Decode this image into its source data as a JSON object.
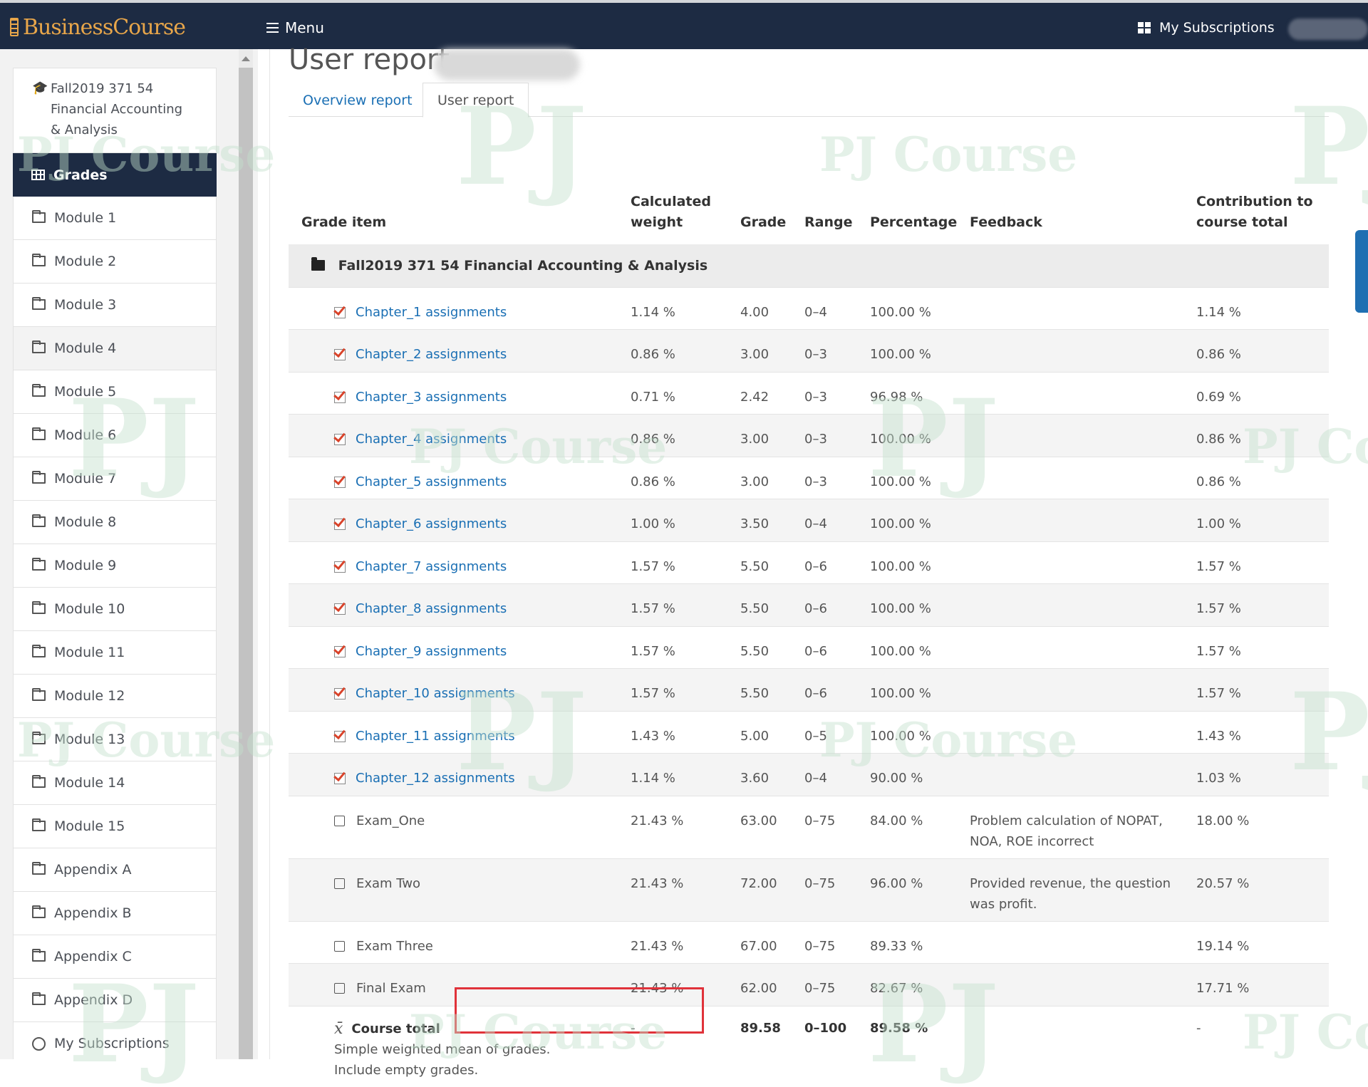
{
  "topbar": {
    "logo_text": "BusinessCourse",
    "menu_label": "Menu",
    "subscriptions_label": "My Subscriptions"
  },
  "sidebar": {
    "course_name": "Fall2019 371 54 Financial Accounting & Analysis",
    "active_label": "Grades",
    "items": [
      "Module 1",
      "Module 2",
      "Module 3",
      "Module 4",
      "Module 5",
      "Module 6",
      "Module 7",
      "Module 8",
      "Module 9",
      "Module 10",
      "Module 11",
      "Module 12",
      "Module 13",
      "Module 14",
      "Module 15",
      "Appendix A",
      "Appendix B",
      "Appendix C",
      "Appendix D"
    ],
    "bottom_item": "My Subscriptions"
  },
  "page": {
    "title": "User report",
    "tabs": [
      "Overview report",
      "User report"
    ]
  },
  "table": {
    "headers": {
      "item": "Grade item",
      "weight": "Calculated weight",
      "grade": "Grade",
      "range": "Range",
      "percentage": "Percentage",
      "feedback": "Feedback",
      "contribution": "Contribution to course total"
    },
    "category": "Fall2019 371 54 Financial Accounting & Analysis",
    "assignments": [
      {
        "name": "Chapter_1 assignments",
        "weight": "1.14 %",
        "grade": "4.00",
        "range": "0–4",
        "percentage": "100.00 %",
        "feedback": "",
        "contribution": "1.14 %"
      },
      {
        "name": "Chapter_2 assignments",
        "weight": "0.86 %",
        "grade": "3.00",
        "range": "0–3",
        "percentage": "100.00 %",
        "feedback": "",
        "contribution": "0.86 %"
      },
      {
        "name": "Chapter_3 assignments",
        "weight": "0.71 %",
        "grade": "2.42",
        "range": "0–3",
        "percentage": "96.98 %",
        "feedback": "",
        "contribution": "0.69 %"
      },
      {
        "name": "Chapter_4 assignments",
        "weight": "0.86 %",
        "grade": "3.00",
        "range": "0–3",
        "percentage": "100.00 %",
        "feedback": "",
        "contribution": "0.86 %"
      },
      {
        "name": "Chapter_5 assignments",
        "weight": "0.86 %",
        "grade": "3.00",
        "range": "0–3",
        "percentage": "100.00 %",
        "feedback": "",
        "contribution": "0.86 %"
      },
      {
        "name": "Chapter_6 assignments",
        "weight": "1.00 %",
        "grade": "3.50",
        "range": "0–4",
        "percentage": "100.00 %",
        "feedback": "",
        "contribution": "1.00 %"
      },
      {
        "name": "Chapter_7 assignments",
        "weight": "1.57 %",
        "grade": "5.50",
        "range": "0–6",
        "percentage": "100.00 %",
        "feedback": "",
        "contribution": "1.57 %"
      },
      {
        "name": "Chapter_8 assignments",
        "weight": "1.57 %",
        "grade": "5.50",
        "range": "0–6",
        "percentage": "100.00 %",
        "feedback": "",
        "contribution": "1.57 %"
      },
      {
        "name": "Chapter_9 assignments",
        "weight": "1.57 %",
        "grade": "5.50",
        "range": "0–6",
        "percentage": "100.00 %",
        "feedback": "",
        "contribution": "1.57 %"
      },
      {
        "name": "Chapter_10 assignments",
        "weight": "1.57 %",
        "grade": "5.50",
        "range": "0–6",
        "percentage": "100.00 %",
        "feedback": "",
        "contribution": "1.57 %"
      },
      {
        "name": "Chapter_11 assignments",
        "weight": "1.43 %",
        "grade": "5.00",
        "range": "0–5",
        "percentage": "100.00 %",
        "feedback": "",
        "contribution": "1.43 %"
      },
      {
        "name": "Chapter_12 assignments",
        "weight": "1.14 %",
        "grade": "3.60",
        "range": "0–4",
        "percentage": "90.00 %",
        "feedback": "",
        "contribution": "1.03 %"
      }
    ],
    "exams": [
      {
        "name": "Exam_One",
        "weight": "21.43 %",
        "grade": "63.00",
        "range": "0–75",
        "percentage": "84.00 %",
        "feedback": "Problem calculation of NOPAT, NOA, ROE incorrect",
        "contribution": "18.00 %"
      },
      {
        "name": "Exam Two",
        "weight": "21.43 %",
        "grade": "72.00",
        "range": "0–75",
        "percentage": "96.00 %",
        "feedback": "Provided revenue, the question was profit.",
        "contribution": "20.57 %"
      },
      {
        "name": "Exam Three",
        "weight": "21.43 %",
        "grade": "67.00",
        "range": "0–75",
        "percentage": "89.33 %",
        "feedback": "",
        "contribution": "19.14 %"
      },
      {
        "name": "Final Exam",
        "weight": "21.43 %",
        "grade": "62.00",
        "range": "0–75",
        "percentage": "82.67 %",
        "feedback": "",
        "contribution": "17.71 %"
      }
    ],
    "total": {
      "name": "Course total",
      "desc1": "Simple weighted mean of grades.",
      "desc2": "Include empty grades.",
      "weight": "-",
      "grade": "89.58",
      "range": "0–100",
      "percentage": "89.58 %",
      "contribution": "-"
    }
  },
  "watermark": {
    "short": "PJ",
    "long": "PJ Course",
    "cut": "PJ Co"
  },
  "colors": {
    "navbar": "#1d2b43",
    "link": "#1a6fb4",
    "highlight": "#e0323a",
    "logo": "#e8a64a"
  }
}
